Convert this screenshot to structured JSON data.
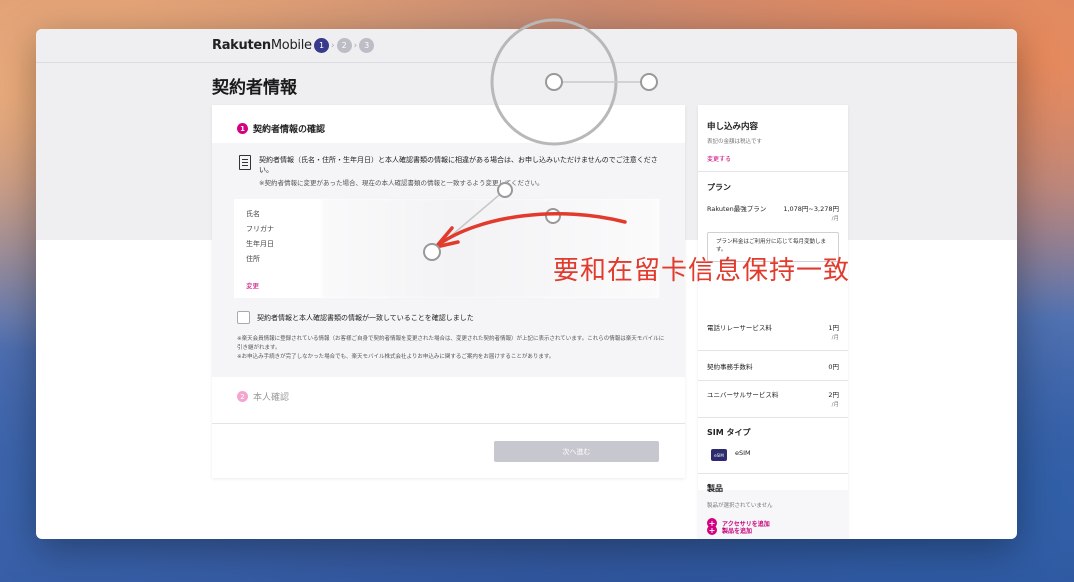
{
  "header": {
    "logo_bold": "Rakuten",
    "logo_light": "Mobile",
    "steps": [
      "1",
      "2",
      "3"
    ],
    "step_sep": "›"
  },
  "page": {
    "title": "契約者情報"
  },
  "section1": {
    "number": "1",
    "title": "契約者情報の確認",
    "notice": "契約者情報（氏名・住所・生年月日）と本人確認書類の情報に相違がある場合は、お申し込みいただけませんのでご注意ください。",
    "notice_sub": "※契約者情報に変更があった場合、現在の本人確認書類の情報と一致するよう変更してください。",
    "fields": [
      "氏名",
      "フリガナ",
      "生年月日",
      "住所"
    ],
    "change_link": "変更",
    "checkbox_label": "契約者情報と本人確認書類の情報が一致していることを確認しました",
    "footnote_1": "※楽天会員情報に登録されている情報（お客様ご自身で契約者情報を変更された場合は、変更された契約者情報）が上記に表示されています。これらの情報は楽天モバイルに引き継がれます。",
    "footnote_2": "※お申込み手続きが完了しなかった場合でも、楽天モバイル株式会社よりお申込みに関するご案内をお届けすることがあります。"
  },
  "section2": {
    "number": "2",
    "title": "本人確認"
  },
  "next_button": "次へ進む",
  "sidebar": {
    "title": "申し込み内容",
    "subtitle": "表記の金額は税込です",
    "change_link": "変更する",
    "plan_heading": "プラン",
    "plan_name": "Rakuten最強プラン",
    "plan_price": "1,078円~3,278円",
    "plan_unit": "/月",
    "plan_note": "プラン料金はご利用分に応じて毎月変動します。",
    "fees": [
      {
        "label": "電話リレーサービス料",
        "value": "1円",
        "unit": "/月"
      },
      {
        "label": "契約事務手数料",
        "value": "0円",
        "unit": ""
      },
      {
        "label": "ユニバーサルサービス料",
        "value": "2円",
        "unit": "/月"
      }
    ],
    "sim_heading": "SIM タイプ",
    "sim_chip": "eSIM",
    "sim_type": "eSIM",
    "product_heading": "製品",
    "product_empty": "製品が選択されていません",
    "add_product": "製品を追加",
    "add_accessory": "アクセサリを追加"
  },
  "annotation": {
    "text": "要和在留卡信息保持一致",
    "color": "#e23a2c"
  },
  "colors": {
    "accent": "#d5007f",
    "step_active": "#3a3a8c",
    "annotation": "#e23a2c"
  }
}
